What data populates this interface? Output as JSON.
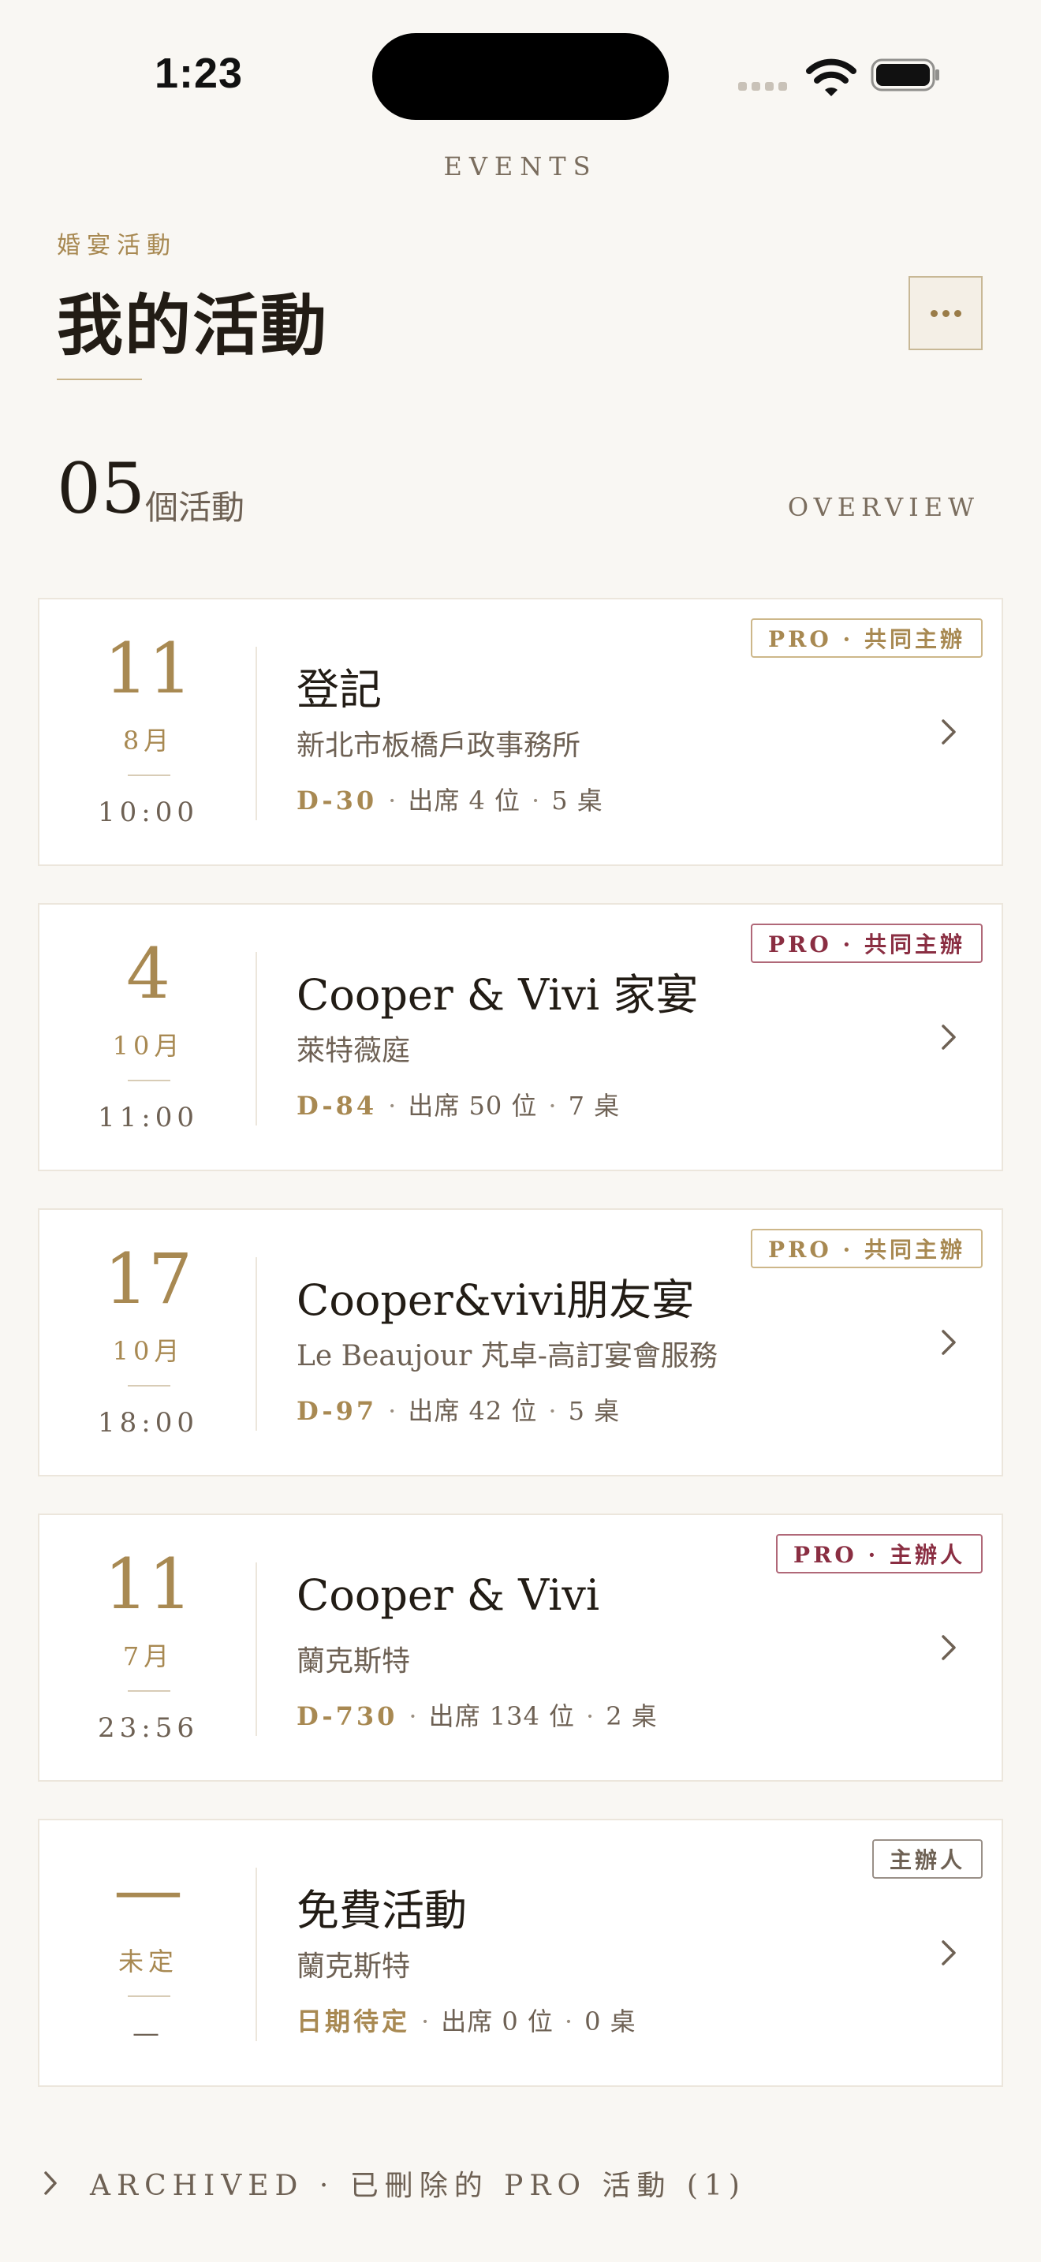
{
  "status_bar": {
    "time": "1:23"
  },
  "header": {
    "nav_title": "EVENTS",
    "eyebrow": "婚宴活動",
    "title": "我的活動"
  },
  "summary": {
    "count": "05",
    "unit": "個活動",
    "overview_label": "OVERVIEW"
  },
  "events": [
    {
      "day": "11",
      "month": "8月",
      "time": "10:00",
      "name": "登記",
      "venue": "新北市板橋戶政事務所",
      "countdown": "D-30",
      "attendees": "出席 4 位",
      "tables": "5 桌",
      "badge": "PRO · 共同主辦"
    },
    {
      "day": "4",
      "month": "10月",
      "time": "11:00",
      "name": "Cooper & Vivi 家宴",
      "venue": "萊特薇庭",
      "countdown": "D-84",
      "attendees": "出席 50 位",
      "tables": "7 桌",
      "badge": "PRO · 共同主辦"
    },
    {
      "day": "17",
      "month": "10月",
      "time": "18:00",
      "name": "Cooper&vivi朋友宴",
      "venue": "Le Beaujour 芃卓-高訂宴會服務",
      "countdown": "D-97",
      "attendees": "出席 42 位",
      "tables": "5 桌",
      "badge": "PRO · 共同主辦"
    },
    {
      "day": "11",
      "month": "7月",
      "time": "23:56",
      "name": "Cooper & Vivi",
      "venue": "蘭克斯特",
      "countdown": "D-730",
      "attendees": "出席 134 位",
      "tables": "2 桌",
      "badge": "PRO · 主辦人"
    },
    {
      "day": "—",
      "month": "未定",
      "time": "—",
      "name": "免費活動",
      "venue": "蘭克斯特",
      "countdown": "日期待定",
      "attendees": "出席 0 位",
      "tables": "0 桌",
      "badge": "主辦人"
    }
  ],
  "separator": "·",
  "archived_label": "ARCHIVED · 已刪除的 PRO 活動 (1)",
  "colors": {
    "background": "#f9f7f3",
    "gold": "#a88952",
    "wine": "#8a2e42",
    "text": "#221c15",
    "muted": "#6e6154"
  }
}
